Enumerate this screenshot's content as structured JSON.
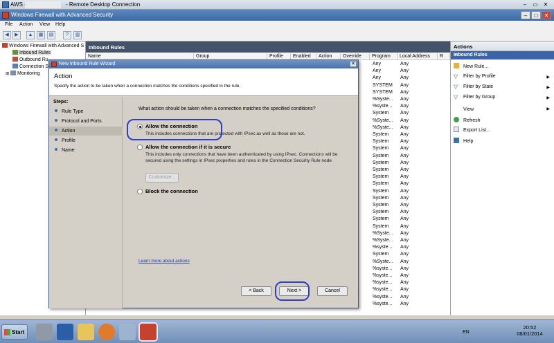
{
  "rdp": {
    "host": "AWS -",
    "title": "- Remote Desktop Connection",
    "minimize": "–",
    "restore": "▭",
    "close": "✕"
  },
  "window": {
    "title": "Windows Firewall with Advanced Security",
    "min": "–",
    "max": "□",
    "close": "✕"
  },
  "menu": [
    "File",
    "Action",
    "View",
    "Help"
  ],
  "toolbar": [
    "◀",
    "▶",
    "▲",
    "▦",
    "▤",
    "?",
    "▥"
  ],
  "tree": {
    "root": "Windows Firewall with Advanced S",
    "items": [
      "Inbound Rules",
      "Outbound Ru",
      "Connection Se",
      "Monitoring"
    ]
  },
  "middle": {
    "header": "Inbound Rules",
    "columns": [
      "Name",
      "Group",
      "Profile",
      "Enabled",
      "Action",
      "Override",
      "Program",
      "Local Address",
      "R"
    ],
    "program_col": [
      "Any",
      "Any",
      "Any",
      "SYSTEM",
      "SYSTEM",
      "%Syste...",
      "%syste...",
      "System",
      "%Syste...",
      "%Syste...",
      "System",
      "System",
      "System",
      "System",
      "System",
      "System",
      "System",
      "System",
      "System",
      "System",
      "System",
      "System",
      "System",
      "System",
      "%Syste...",
      "%Syste...",
      "%syste...",
      "System",
      "%Syste...",
      "%syste...",
      "%syste...",
      "%syste...",
      "%syste...",
      "%syste...",
      "%syste..."
    ],
    "local_col": "Any"
  },
  "actions": {
    "header": "Actions",
    "sub": "Inbound Rules",
    "items": [
      "New Rule...",
      "Filter by Profile",
      "Filter by State",
      "Filter by Group",
      "View",
      "Refresh",
      "Export List...",
      "Help"
    ]
  },
  "wizard": {
    "title": "New Inbound Rule Wizard",
    "close": "✕",
    "heading": "Action",
    "description": "Specify the action to be taken when a connection matches the conditions specified in the rule.",
    "steps_title": "Steps:",
    "steps": [
      "Rule Type",
      "Protocol and Ports",
      "Action",
      "Profile",
      "Name"
    ],
    "question": "What action should be taken when a connection matches the specified conditions?",
    "options": [
      {
        "label": "Allow the connection",
        "desc": "This includes connections that are protected with IPsec as well as those are not."
      },
      {
        "label": "Allow the connection if it is secure",
        "desc": "This includes only connections that have been authenticated by using IPsec.  Connections will be secured using the settings in IPsec properties and rules in the Connection Security Rule node."
      },
      {
        "label": "Block the connection",
        "desc": ""
      }
    ],
    "customize": "Customize...",
    "learn_more": "Learn more about actions",
    "back": "< Back",
    "next": "Next >",
    "cancel": "Cancel"
  },
  "taskbar": {
    "start": "Start",
    "lang": "EN",
    "time": "20:52",
    "date": "08/01/2014"
  },
  "colors": {
    "annotation": "#2c3fc6",
    "pane_header": "#44536a",
    "actions_sub": "#3d65a5"
  }
}
